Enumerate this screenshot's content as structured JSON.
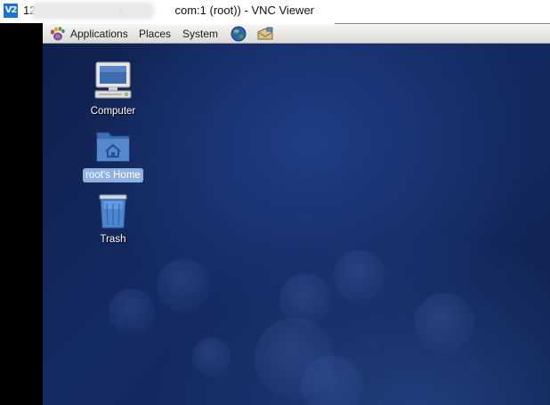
{
  "window": {
    "logo_text": "V2",
    "title": "12                          (                com:1 (root)) - VNC Viewer"
  },
  "panel": {
    "menus": [
      {
        "label": "Applications",
        "icon": "gnome-foot-icon"
      },
      {
        "label": "Places"
      },
      {
        "label": "System"
      }
    ],
    "launchers": [
      {
        "icon": "web-browser-icon"
      },
      {
        "icon": "mail-client-icon"
      }
    ]
  },
  "desktop": {
    "icons": [
      {
        "label": "Computer",
        "icon": "computer-icon",
        "selected": false
      },
      {
        "label": "root's Home",
        "icon": "home-folder-icon",
        "selected": true
      },
      {
        "label": "Trash",
        "icon": "trash-icon",
        "selected": false
      }
    ]
  },
  "colors": {
    "desktop_background": "#14285d",
    "panel_background": "#e8e7e3",
    "selection": "#8fb2e0",
    "vnc_logo": "#1b74d1"
  }
}
